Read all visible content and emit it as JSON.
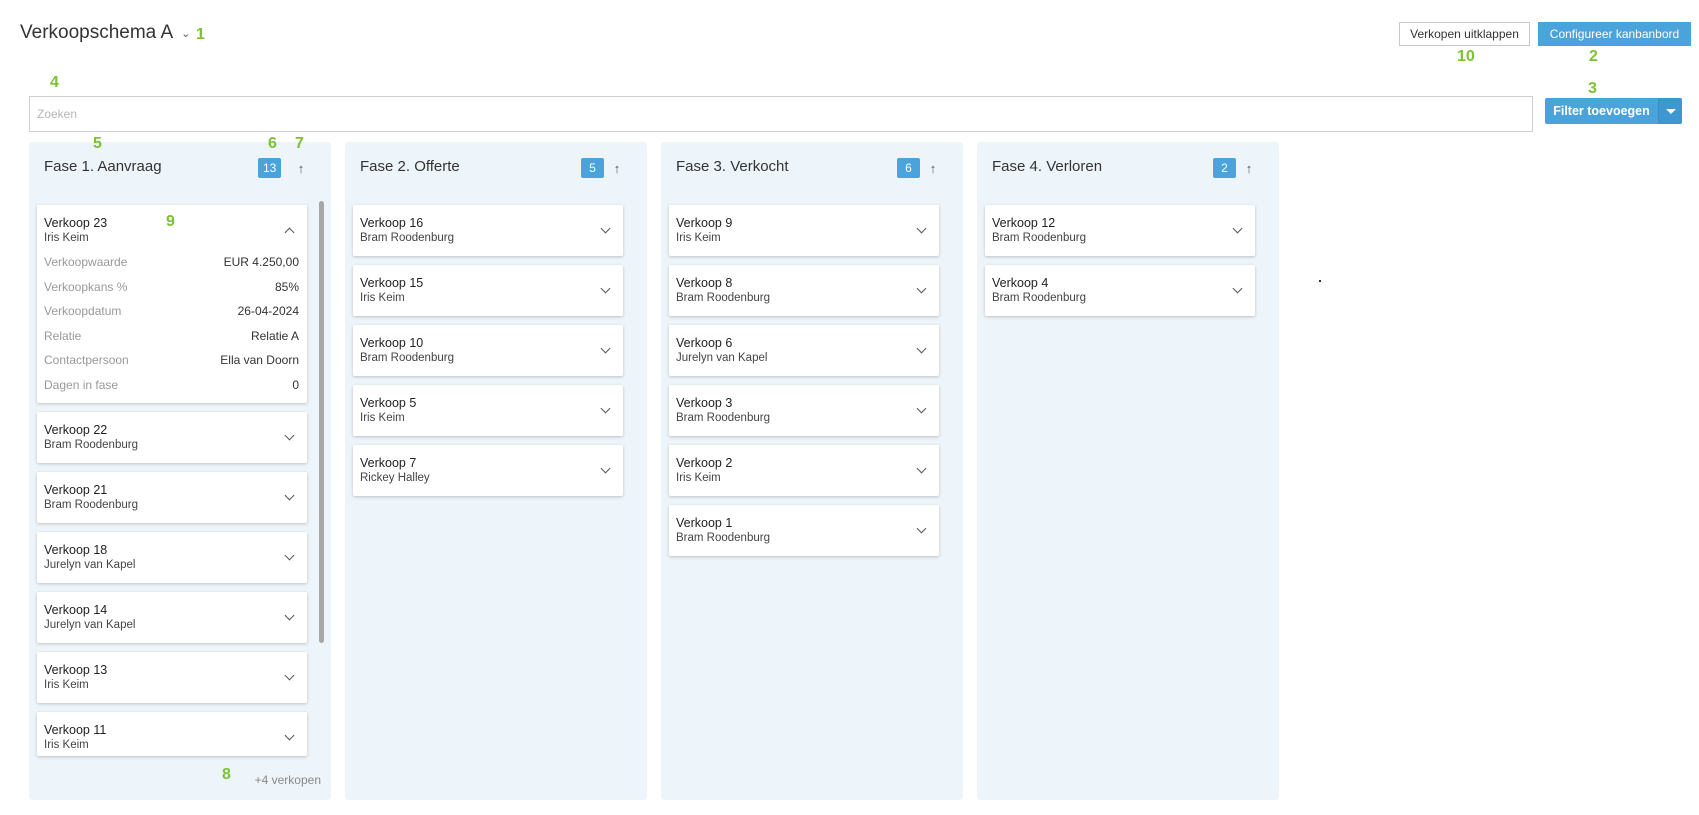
{
  "header": {
    "schema_title": "Verkoopschema A",
    "collapse_label": "Verkopen uitklappen",
    "configure_label": "Configureer kanbanbord"
  },
  "search": {
    "placeholder": "Zoeken"
  },
  "filter": {
    "label": "Filter toevoegen"
  },
  "annotations": [
    "1",
    "2",
    "3",
    "4",
    "5",
    "6",
    "7",
    "8",
    "9",
    "10"
  ],
  "columns": [
    {
      "title": "Fase 1. Aanvraag",
      "count": "13",
      "more": "+4 verkopen",
      "cards": [
        {
          "title": "Verkoop 23",
          "subtitle": "Iris Keim",
          "expanded": true,
          "fields": [
            {
              "key": "Verkoopwaarde",
              "value": "EUR 4.250,00"
            },
            {
              "key": "Verkoopkans %",
              "value": "85%"
            },
            {
              "key": "Verkoopdatum",
              "value": "26-04-2024"
            },
            {
              "key": "Relatie",
              "value": "Relatie A"
            },
            {
              "key": "Contactpersoon",
              "value": "Ella van Doorn"
            },
            {
              "key": "Dagen in fase",
              "value": "0"
            }
          ]
        },
        {
          "title": "Verkoop 22",
          "subtitle": "Bram Roodenburg"
        },
        {
          "title": "Verkoop 21",
          "subtitle": "Bram Roodenburg"
        },
        {
          "title": "Verkoop 18",
          "subtitle": "Jurelyn van Kapel"
        },
        {
          "title": "Verkoop 14",
          "subtitle": "Jurelyn van Kapel"
        },
        {
          "title": "Verkoop 13",
          "subtitle": "Iris Keim"
        },
        {
          "title": "Verkoop 11",
          "subtitle": "Iris Keim"
        }
      ]
    },
    {
      "title": "Fase 2. Offerte",
      "count": "5",
      "cards": [
        {
          "title": "Verkoop 16",
          "subtitle": "Bram Roodenburg"
        },
        {
          "title": "Verkoop 15",
          "subtitle": "Iris Keim"
        },
        {
          "title": "Verkoop 10",
          "subtitle": "Bram Roodenburg"
        },
        {
          "title": "Verkoop 5",
          "subtitle": "Iris Keim"
        },
        {
          "title": "Verkoop 7",
          "subtitle": "Rickey Halley"
        }
      ]
    },
    {
      "title": "Fase 3. Verkocht",
      "count": "6",
      "cards": [
        {
          "title": "Verkoop 9",
          "subtitle": "Iris Keim"
        },
        {
          "title": "Verkoop 8",
          "subtitle": "Bram Roodenburg"
        },
        {
          "title": "Verkoop 6",
          "subtitle": "Jurelyn van Kapel"
        },
        {
          "title": "Verkoop 3",
          "subtitle": "Bram Roodenburg"
        },
        {
          "title": "Verkoop 2",
          "subtitle": "Iris Keim"
        },
        {
          "title": "Verkoop 1",
          "subtitle": "Bram Roodenburg"
        }
      ]
    },
    {
      "title": "Fase 4. Verloren",
      "count": "2",
      "cards": [
        {
          "title": "Verkoop 12",
          "subtitle": "Bram Roodenburg"
        },
        {
          "title": "Verkoop 4",
          "subtitle": "Bram Roodenburg"
        }
      ]
    }
  ]
}
